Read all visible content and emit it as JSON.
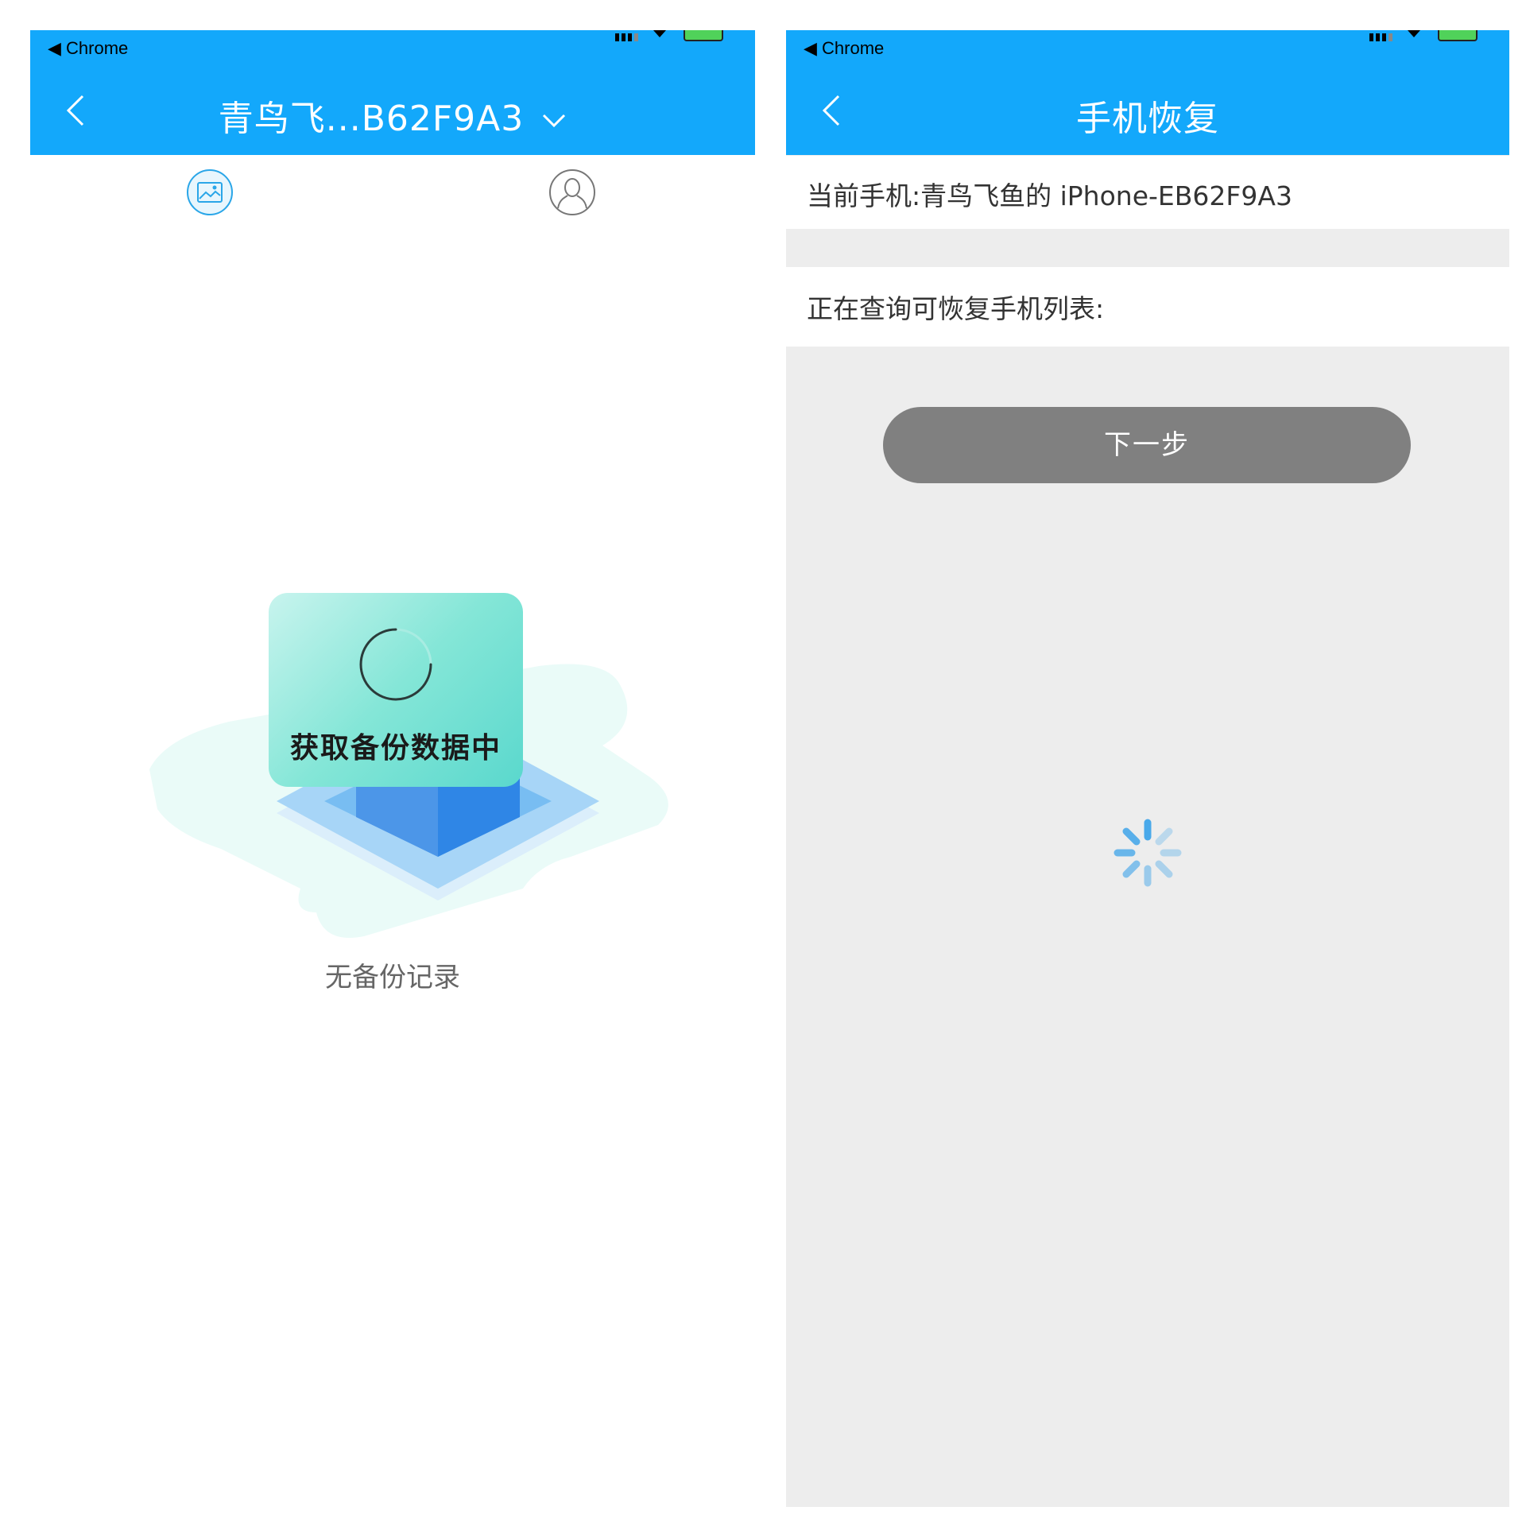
{
  "colors": {
    "primary": "#13a8fb",
    "toast_gradient_start": "#c8f4ee",
    "toast_gradient_end": "#5ad8cd",
    "button_disabled": "#808080",
    "background_gray": "#ededed"
  },
  "left": {
    "status_bar": {
      "back_app": "◀ Chrome"
    },
    "nav": {
      "title": "青鸟飞...B62F9A3"
    },
    "tabs": [
      {
        "icon": "photo-icon"
      },
      {
        "icon": "contact-icon"
      }
    ],
    "toast": {
      "text": "获取备份数据中"
    },
    "empty": {
      "text": "无备份记录"
    }
  },
  "right": {
    "status_bar": {
      "back_app": "◀ Chrome"
    },
    "nav": {
      "title": "手机恢复"
    },
    "current_phone": "当前手机:青鸟飞鱼的 iPhone-EB62F9A3",
    "query_label": "正在查询可恢复手机列表:",
    "next_button": "下一步"
  }
}
